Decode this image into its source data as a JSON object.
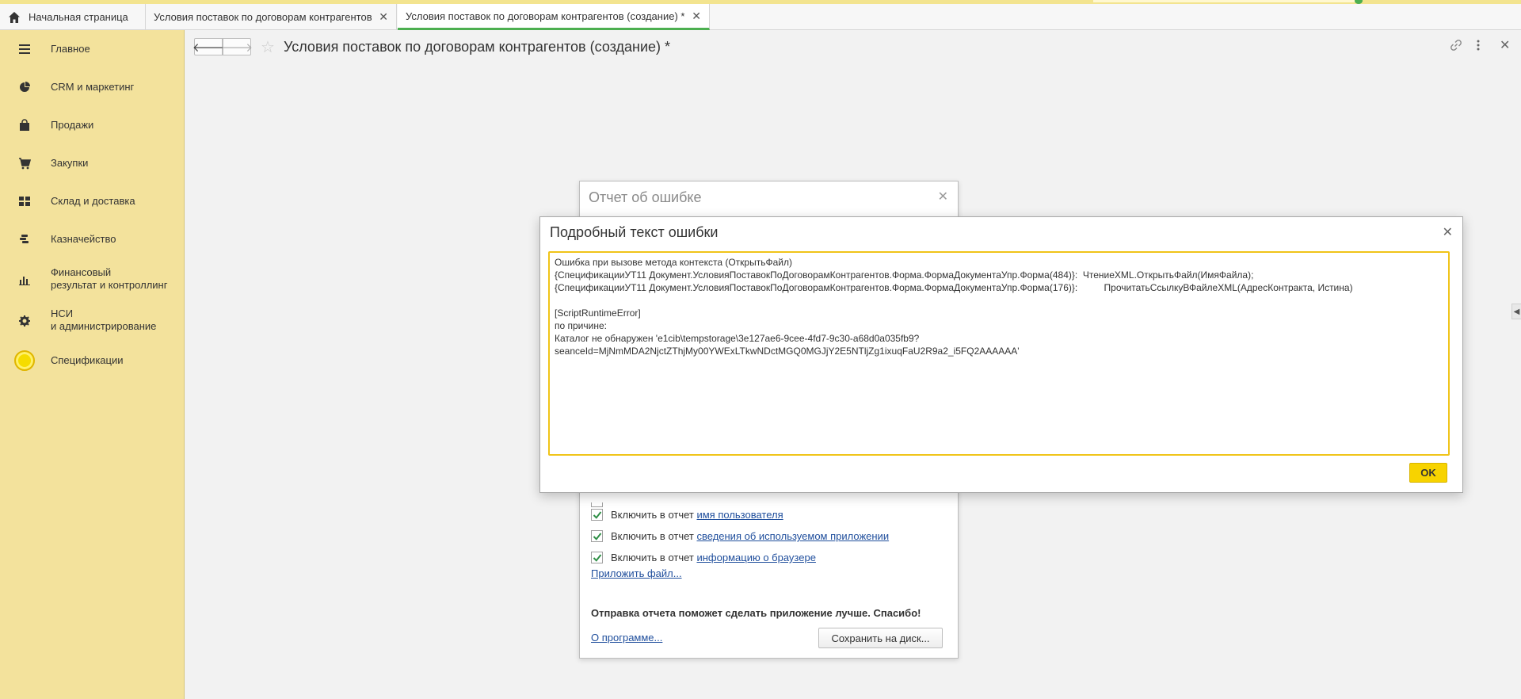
{
  "tabs": {
    "home": "Начальная страница",
    "tab1": "Условия поставок по договорам контрагентов",
    "tab2": "Условия поставок по договорам контрагентов (создание) *"
  },
  "sidebar": {
    "items": [
      {
        "label": "Главное",
        "icon": "menu-icon"
      },
      {
        "label": "CRM и маркетинг",
        "icon": "pie-chart-icon"
      },
      {
        "label": "Продажи",
        "icon": "shopping-bag-icon"
      },
      {
        "label": "Закупки",
        "icon": "cart-icon"
      },
      {
        "label": "Склад и доставка",
        "icon": "warehouse-grid-icon"
      },
      {
        "label": "Казначейство",
        "icon": "coins-icon"
      },
      {
        "label": "Финансовый\nрезультат и контроллинг",
        "icon": "bar-chart-icon"
      },
      {
        "label": "НСИ\nи администрирование",
        "icon": "gear-icon"
      },
      {
        "label": "Спецификации",
        "icon": "yellow-circle-icon"
      }
    ]
  },
  "form": {
    "title": "Условия поставок по договорам контрагентов (создание) *",
    "back": "🡐",
    "forward": "🡒"
  },
  "report": {
    "title": "Отчет об ошибке",
    "checks": [
      {
        "prefix": "Включить в отчет ",
        "link": "имя пользователя",
        "checked": true
      },
      {
        "prefix": "Включить в отчет ",
        "link": "сведения об используемом приложении",
        "checked": true
      },
      {
        "prefix": "Включить в отчет ",
        "link": "информацию о браузере",
        "checked": true
      }
    ],
    "attach": "Приложить файл...",
    "thanks": "Отправка отчета поможет сделать приложение лучше. Спасибо!",
    "about": "О программе...",
    "save": "Сохранить на диск..."
  },
  "detail": {
    "title": "Подробный текст ошибки",
    "text": "Ошибка при вызове метода контекста (ОткрытьФайл)\n{СпецификацииУТ11 Документ.УсловияПоставокПоДоговорамКонтрагентов.Форма.ФормаДокументаУпр.Форма(484)}:  ЧтениеXML.ОткрытьФайл(ИмяФайла);\n{СпецификацииУТ11 Документ.УсловияПоставокПоДоговорамКонтрагентов.Форма.ФормаДокументаУпр.Форма(176)}:          ПрочитатьСсылкуВФайлеXML(АдресКонтракта, Истина)\n\n[ScriptRuntimeError]\nпо причине:\nКаталог не обнаружен 'e1cib\\tempstorage\\3e127ae6-9cee-4fd7-9c30-a68d0a035fb9?\nseanceId=MjNmMDA2NjctZThjMy00YWExLTkwNDctMGQ0MGJjY2E5NTljZg1ixuqFaU2R9a2_i5FQ2AAAAAA'",
    "ok": "OK"
  }
}
